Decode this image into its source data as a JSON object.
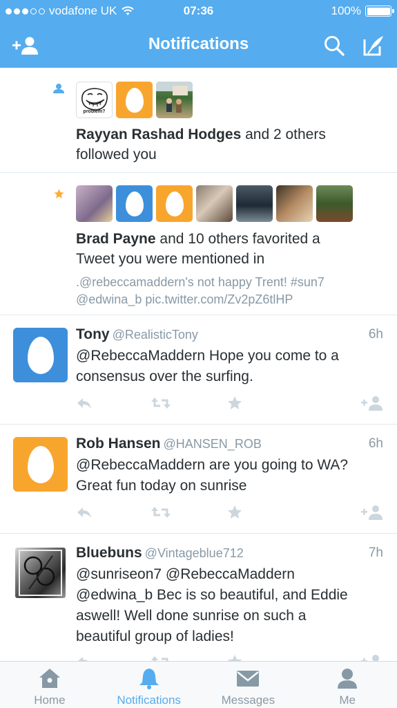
{
  "status_bar": {
    "carrier": "vodafone UK",
    "time": "07:36",
    "battery": "100%"
  },
  "header": {
    "title": "Notifications"
  },
  "notifications": [
    {
      "type": "follow",
      "avatar_problem_text": "problem?",
      "actor": "Rayyan Rashad Hodges",
      "text_rest": " and 2 others",
      "text_line2": "followed you"
    },
    {
      "type": "favorite",
      "actor": "Brad Payne",
      "text_rest": " and 10 others favorited a",
      "text_line2": "Tweet you were mentioned in",
      "quote_line1": ".@rebeccamaddern's not happy Trent! #sun7",
      "quote_line2": "@edwina_b pic.twitter.com/Zv2pZ6tlHP"
    }
  ],
  "tweets": [
    {
      "name": "Tony",
      "handle": "@RealisticTony",
      "time": "6h",
      "lines": [
        "@RebeccaMaddern Hope you come to a",
        "consensus over the surfing."
      ],
      "avatar": "egg-blue"
    },
    {
      "name": "Rob Hansen",
      "handle": "@HANSEN_ROB",
      "time": "6h",
      "lines": [
        "@RebeccaMaddern are you going to WA?",
        "Great fun today on sunrise"
      ],
      "avatar": "egg-orange"
    },
    {
      "name": "Bluebuns",
      "handle": "@Vintageblue712",
      "time": "7h",
      "lines": [
        "@sunriseon7 @RebeccaMaddern",
        "@edwina_b Bec is so beautiful, and Eddie",
        "aswell! Well done sunrise on such a",
        "beautiful group of ladies!"
      ],
      "avatar": "photo"
    }
  ],
  "tabs": [
    {
      "label": "Home",
      "icon": "home-icon"
    },
    {
      "label": "Notifications",
      "icon": "bell-icon",
      "active": true
    },
    {
      "label": "Messages",
      "icon": "envelope-icon"
    },
    {
      "label": "Me",
      "icon": "person-icon"
    }
  ],
  "colors": {
    "brand": "#55acee",
    "text": "#292f33",
    "muted": "#8899a6",
    "favorite": "#ffac33"
  }
}
